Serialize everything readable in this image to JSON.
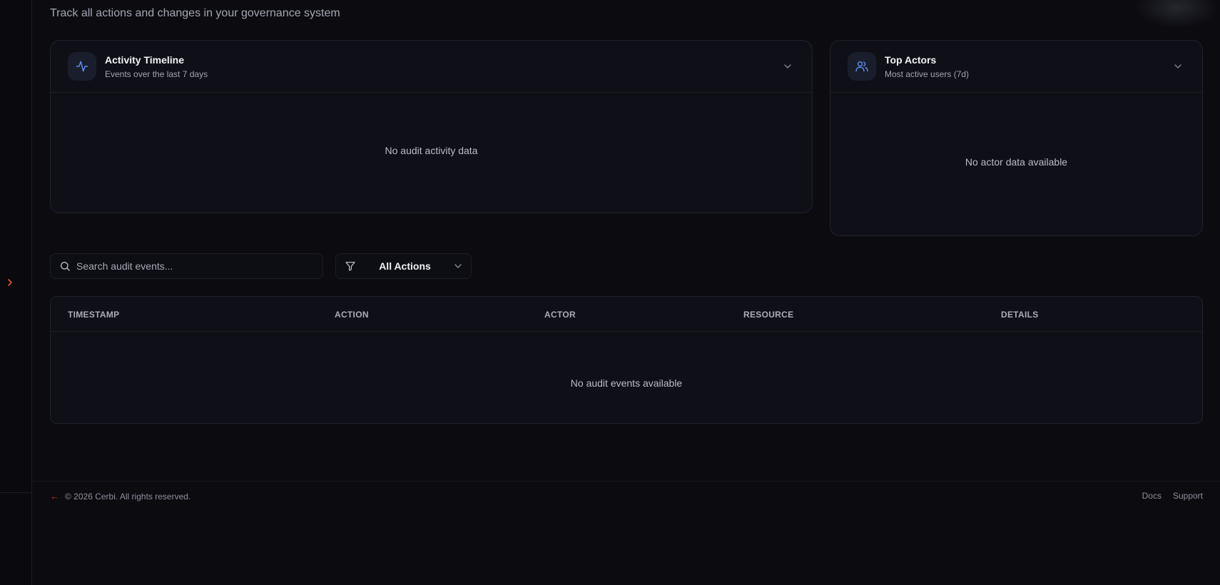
{
  "header": {
    "subtitle": "Track all actions and changes in your governance system"
  },
  "activity_card": {
    "title": "Activity Timeline",
    "subtitle": "Events over the last 7 days",
    "empty_text": "No audit activity data",
    "icon": "activity-icon"
  },
  "actors_card": {
    "title": "Top Actors",
    "subtitle": "Most active users (7d)",
    "empty_text": "No actor data available",
    "icon": "users-icon"
  },
  "search": {
    "placeholder": "Search audit events...",
    "value": ""
  },
  "filter": {
    "selected": "All Actions"
  },
  "table": {
    "columns": [
      "TIMESTAMP",
      "ACTION",
      "ACTOR",
      "RESOURCE",
      "DETAILS"
    ],
    "empty_text": "No audit events available"
  },
  "footer": {
    "copyright": "© 2026 Cerbi. All rights reserved.",
    "links": [
      "Docs",
      "Support"
    ]
  },
  "colors": {
    "accent_blue": "#5b8def",
    "accent_red": "#e4572e",
    "background": "#0b0b10",
    "card": "#0f1017"
  }
}
